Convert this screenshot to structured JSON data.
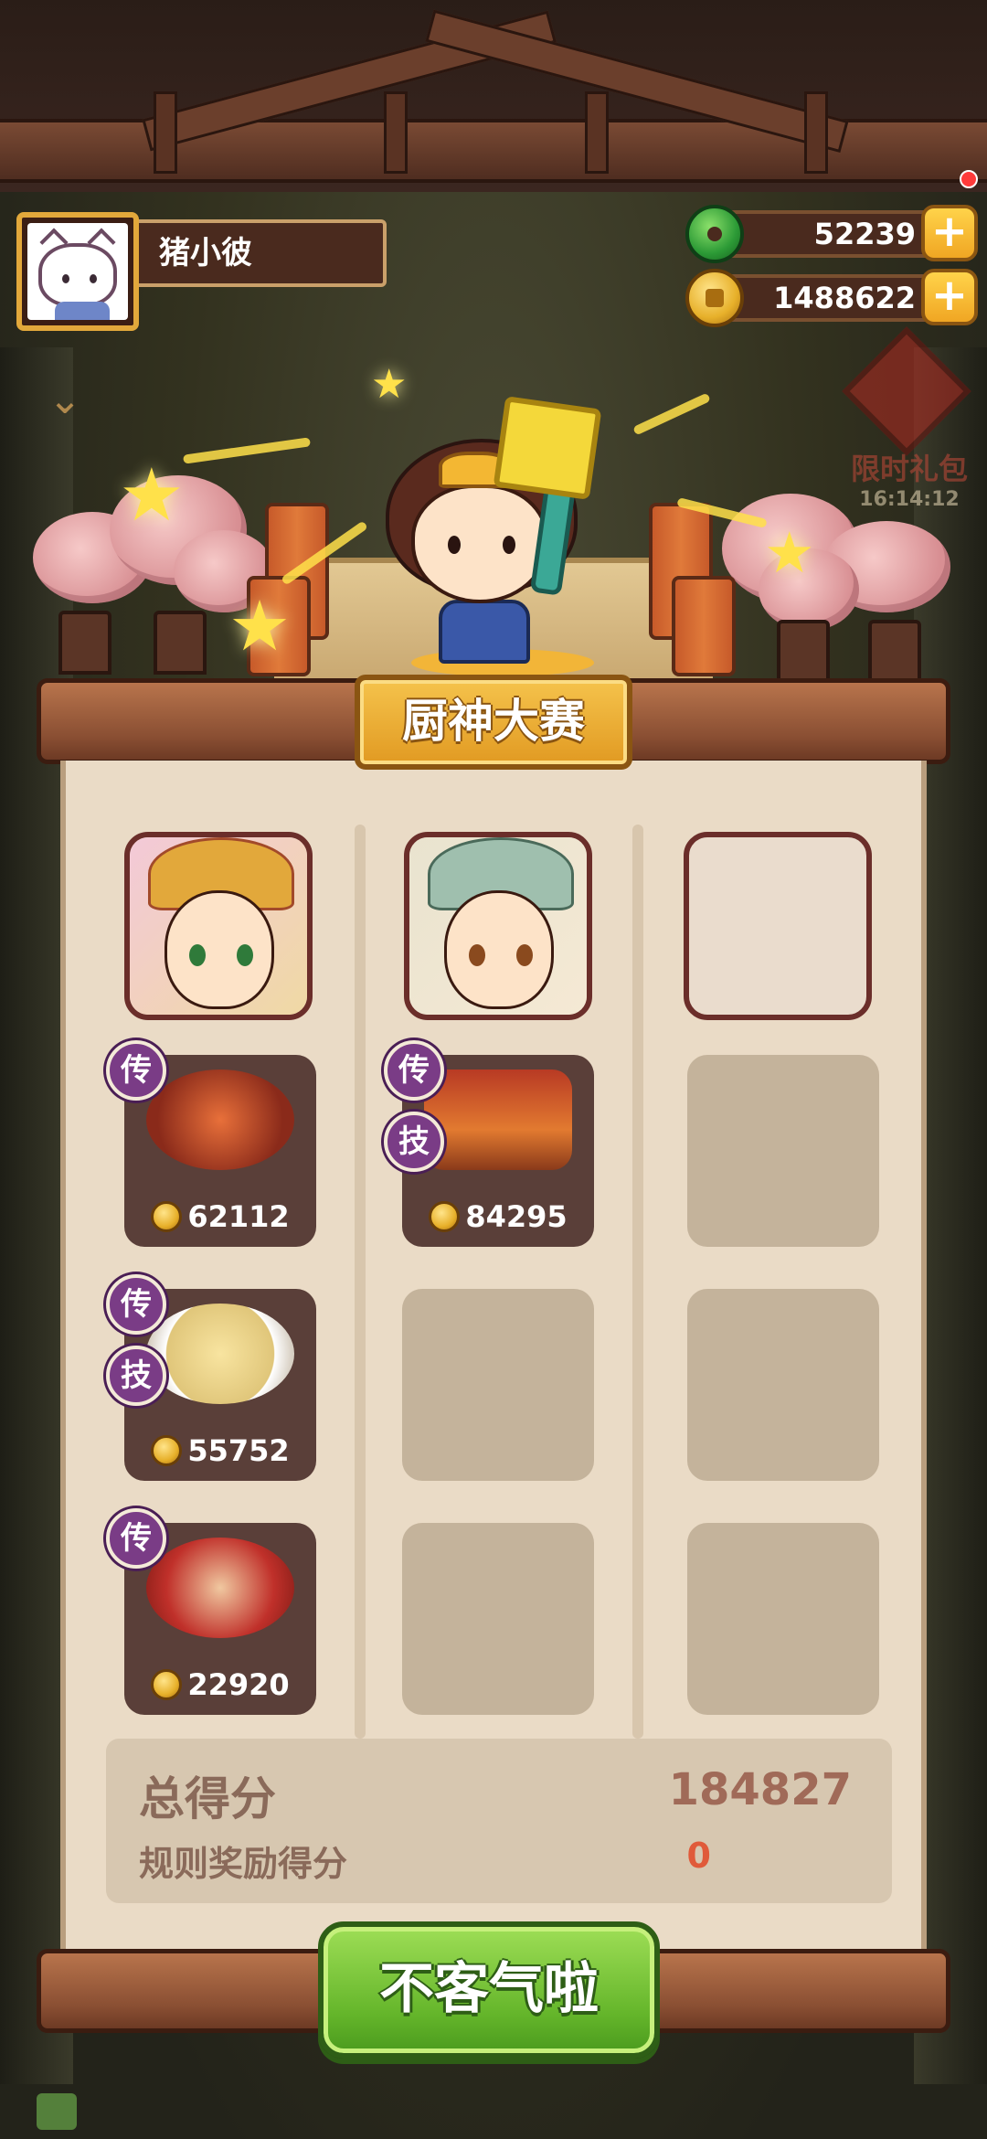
{
  "player": {
    "name": "猪小彼",
    "avatar_icon": "white-cat-avatar-icon"
  },
  "currencies": [
    {
      "name": "jade",
      "icon": "jade-icon",
      "value": "52239",
      "add_label": "+"
    },
    {
      "name": "coin",
      "icon": "coin-icon",
      "value": "1488622",
      "add_label": "+"
    }
  ],
  "gift": {
    "label": "限时礼包",
    "timer": "16:14:12"
  },
  "contest": {
    "title": "厨神大赛",
    "columns": [
      {
        "chef": {
          "present": true,
          "style": "gold-crown-red"
        },
        "dishes": [
          {
            "badges": [
              "传"
            ],
            "value": "62112",
            "dish_icon": "seafood-hotpot-icon",
            "color": "#c84a2a"
          },
          {
            "badges": [
              "传",
              "技"
            ],
            "value": "55752",
            "dish_icon": "egg-custard-bowl-icon",
            "color": "#f2e7c0"
          },
          {
            "badges": [
              "传"
            ],
            "value": "22920",
            "dish_icon": "meat-pot-icon",
            "color": "#c0302a"
          }
        ]
      },
      {
        "chef": {
          "present": true,
          "style": "green-hair-scholar"
        },
        "dishes": [
          {
            "badges": [
              "传",
              "技"
            ],
            "value": "84295",
            "dish_icon": "pavilion-box-icon",
            "color": "#d06a2a"
          },
          null,
          null
        ]
      },
      {
        "chef": {
          "present": false
        },
        "dishes": [
          null,
          null,
          null
        ]
      }
    ],
    "total_label": "总得分",
    "total_value": "184827",
    "bonus_label": "规则奖励得分",
    "bonus_value": "0"
  },
  "confirm_label": "不客气啦",
  "colors": {
    "panel": "#eadbc6",
    "dish_card": "#5a3f39",
    "badge": "#7a3c86",
    "total_value": "#a06a58",
    "bonus_value": "#e05a3a"
  }
}
